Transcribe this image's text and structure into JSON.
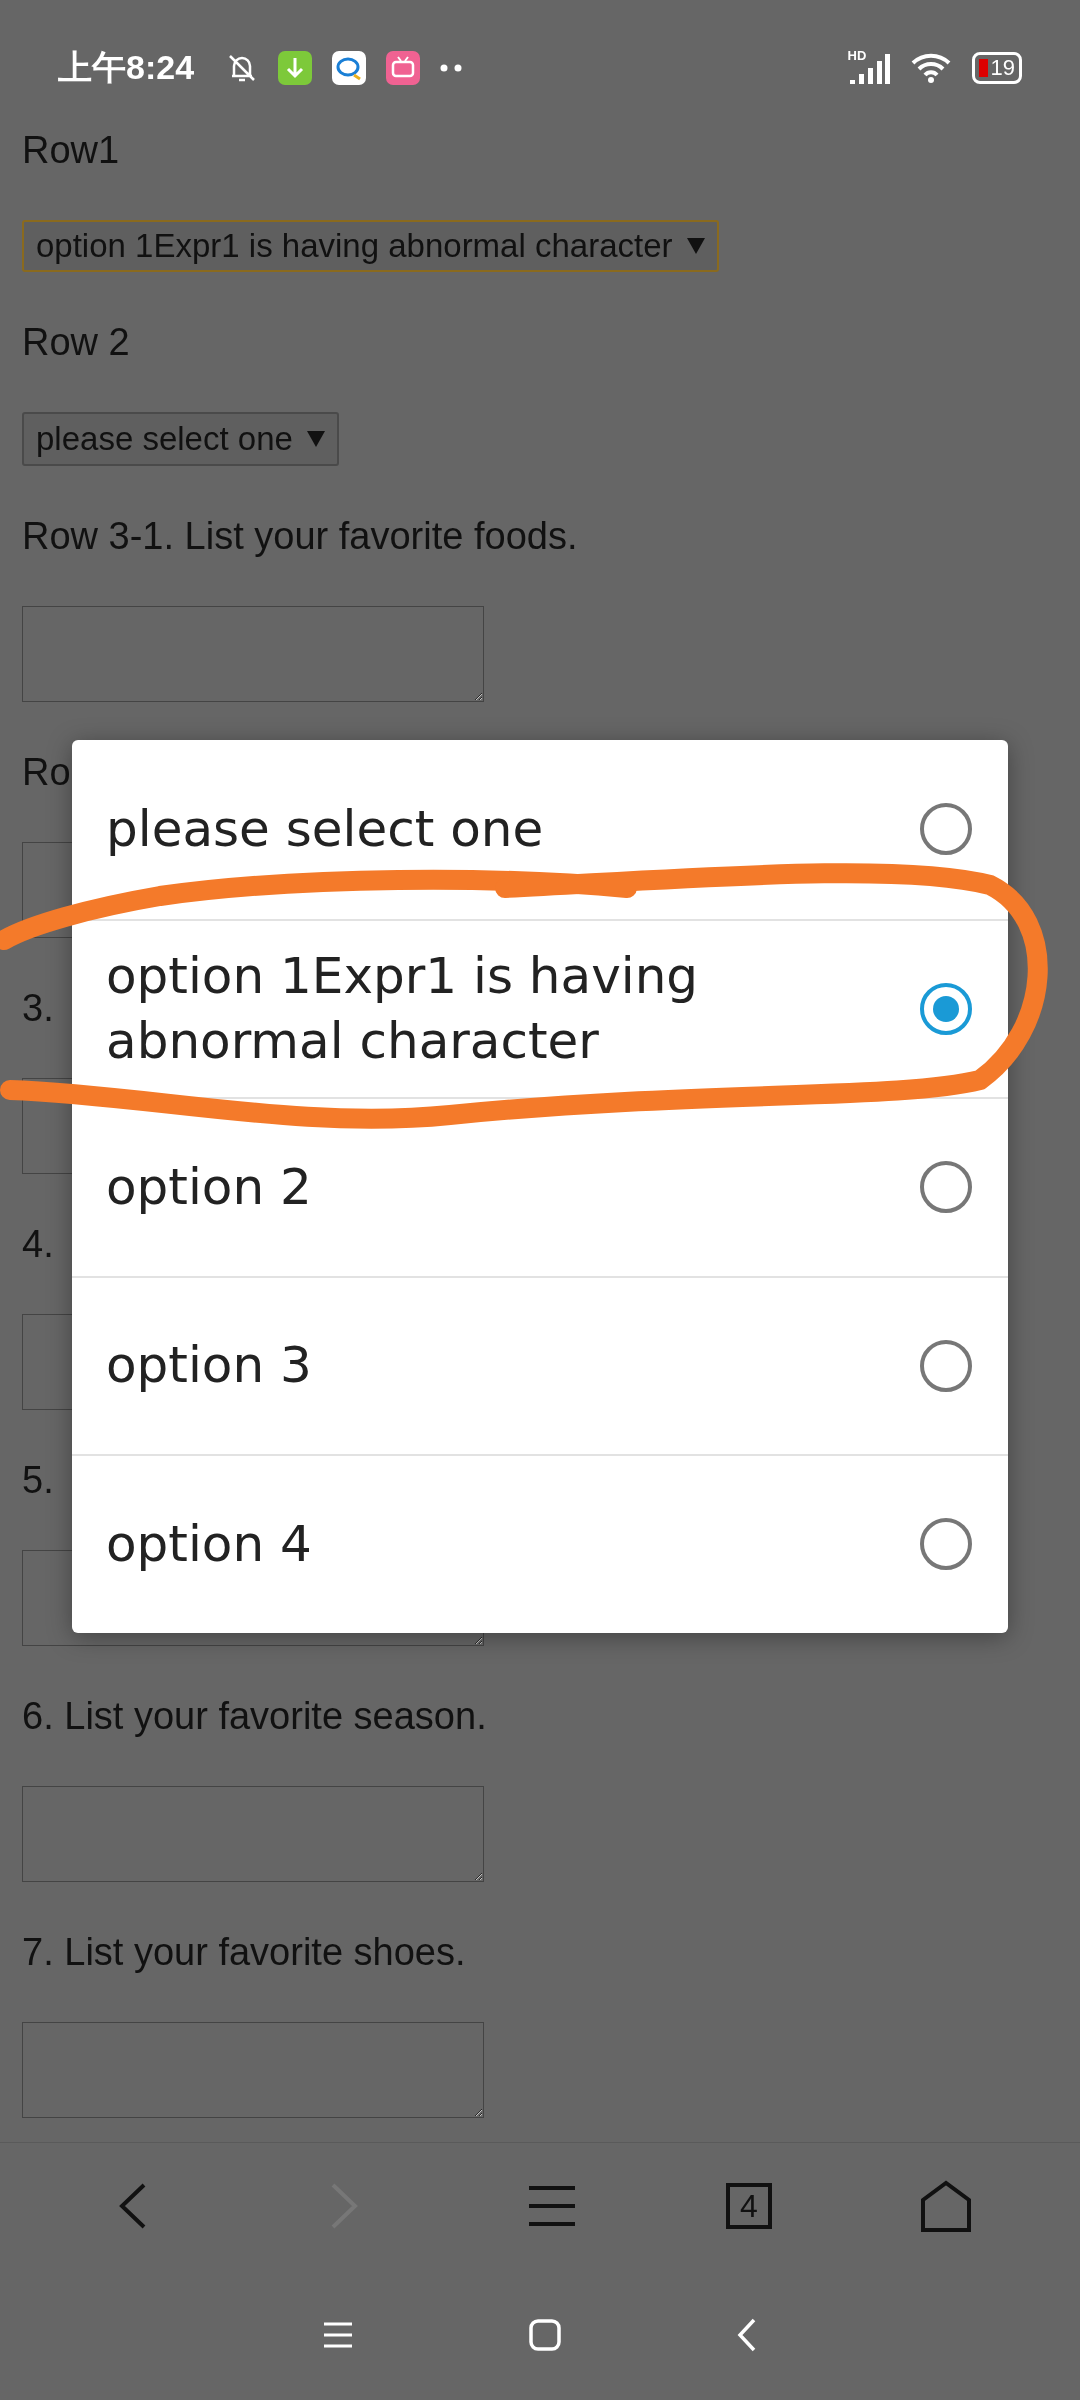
{
  "status_bar": {
    "time": "上午8:24",
    "network": "HD",
    "battery": "19"
  },
  "form": [
    {
      "kind": "select",
      "label": "Row1",
      "value": "option 1Expr1 is having abnormal character",
      "focused": true
    },
    {
      "kind": "select",
      "label": "Row 2",
      "value": "please select one",
      "focused": false
    },
    {
      "kind": "text",
      "label": "Row 3-1. List your favorite foods."
    },
    {
      "kind": "text",
      "label": "Ro"
    },
    {
      "kind": "text",
      "label": "3."
    },
    {
      "kind": "text",
      "label": "4."
    },
    {
      "kind": "text",
      "label": "5."
    },
    {
      "kind": "text",
      "label": "6. List your favorite season."
    },
    {
      "kind": "text",
      "label": "7. List your favorite shoes."
    }
  ],
  "dialog": {
    "options": [
      {
        "label": "please select one",
        "selected": false
      },
      {
        "label": "option 1Expr1 is having abnormal character",
        "selected": true
      },
      {
        "label": "option 2",
        "selected": false
      },
      {
        "label": "option 3",
        "selected": false
      },
      {
        "label": "option 4",
        "selected": false
      }
    ]
  },
  "toolbar": [
    {
      "kind": "back",
      "disabled": false
    },
    {
      "kind": "forward",
      "disabled": true
    },
    {
      "kind": "menu",
      "disabled": false
    },
    {
      "kind": "tabs",
      "label": "4",
      "disabled": false
    },
    {
      "kind": "home",
      "disabled": false
    }
  ]
}
